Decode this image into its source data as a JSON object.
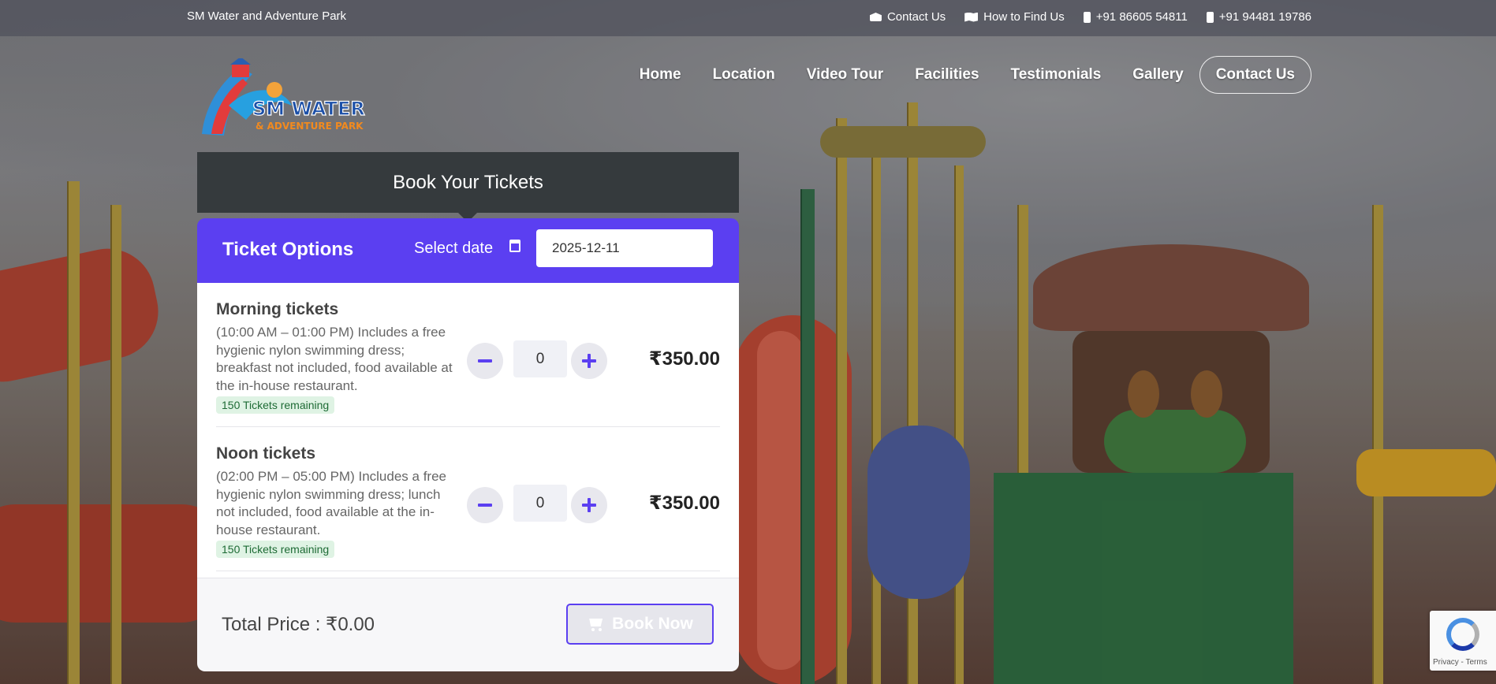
{
  "topbar": {
    "site_name": "SM Water and Adventure Park",
    "links": [
      {
        "icon": "envelope-open-icon",
        "label": "Contact Us"
      },
      {
        "icon": "map-icon",
        "label": "How to Find Us"
      },
      {
        "icon": "phone-icon",
        "label": "+91 86605 54811"
      },
      {
        "icon": "phone-icon",
        "label": "+91 94481 19786"
      }
    ]
  },
  "logo": {
    "line1": "SM WATER",
    "line2": "& ADVENTURE PARK"
  },
  "nav": {
    "items": [
      "Home",
      "Location",
      "Video Tour",
      "Facilities",
      "Testimonials",
      "Gallery"
    ],
    "contact": "Contact Us"
  },
  "booking": {
    "header": "Book Your Tickets",
    "options_title": "Ticket Options",
    "date_label": "Select date",
    "date_value": "2025-12-11",
    "tickets": [
      {
        "name": "Morning tickets",
        "description": "(10:00 AM – 01:00 PM) Includes a free hygienic nylon swimming dress; breakfast not included, food available at the in-house restaurant.",
        "remaining": "150 Tickets remaining",
        "quantity": "0",
        "price": "₹350.00"
      },
      {
        "name": "Noon tickets",
        "description": "(02:00 PM – 05:00 PM) Includes a free hygienic nylon swimming dress; lunch not included, food available at the in-house restaurant.",
        "remaining": "150 Tickets remaining",
        "quantity": "0",
        "price": "₹350.00"
      }
    ],
    "total_label": "Total Price : ₹0.00",
    "book_button": "Book Now"
  },
  "recaptcha": {
    "terms": "Privacy - Terms"
  },
  "colors": {
    "accent": "#5b3ff1",
    "header_dark": "#353a3d",
    "badge_green": "#1e6b35"
  }
}
